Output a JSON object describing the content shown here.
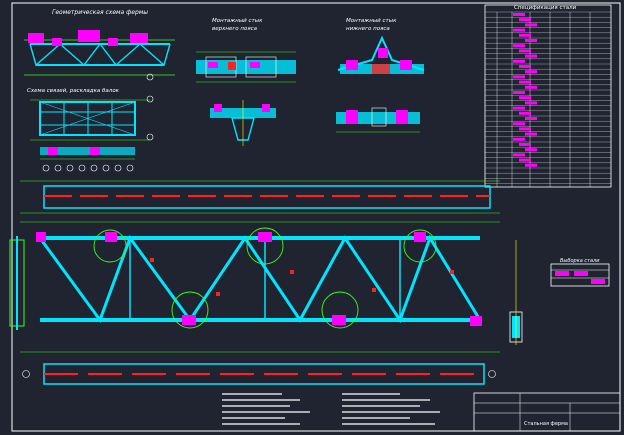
{
  "sheet": {
    "colors": {
      "background": "#1f2430",
      "frame": "#ffffff",
      "member": "#00e5ff",
      "dimension": "#39ff14",
      "highlight": "#ff00ff",
      "hatch": "#ff2020",
      "note": "#ffff00"
    }
  },
  "views": {
    "truss_scheme_title": "Геометрическая схема фермы",
    "upper_node_title_1": "Монтажный стык",
    "upper_node_title_2": "верхнего пояса",
    "lower_node_title_1": "Монтажный стык",
    "lower_node_title_2": "нижнего пояса",
    "bracing_title": "Схема связей, раскладка балок"
  },
  "spec_table": {
    "title": "Спецификация стали",
    "side_title": "Выборка стали"
  },
  "title_block": {
    "drawing_name": "Стальная ферма"
  }
}
